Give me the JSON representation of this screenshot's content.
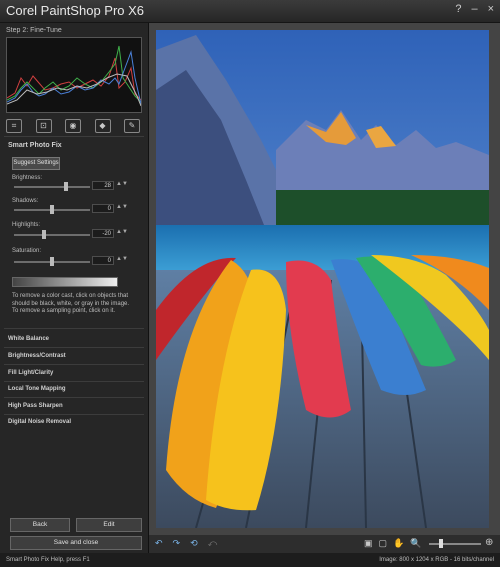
{
  "window": {
    "title": "Corel PaintShop Pro X6",
    "help_label": "?",
    "minimize_label": "–",
    "close_label": "×"
  },
  "left_panel": {
    "step_title": "Step 2: Fine-Tune",
    "smart_photo_fix_title": "Smart Photo Fix",
    "suggest_settings_label": "Suggest Settings",
    "sliders": [
      {
        "label": "Brightness:",
        "value": "28"
      },
      {
        "label": "Shadows:",
        "value": "0"
      },
      {
        "label": "Highlights:",
        "value": "-20"
      },
      {
        "label": "Saturation:",
        "value": "0"
      }
    ],
    "instruction": "To remove a color cast, click on objects that should be black, white, or gray in the image. To remove a sampling point, click on it.",
    "sections": [
      "White Balance",
      "Brightness/Contrast",
      "Fill Light/Clarity",
      "Local Tone Mapping",
      "High Pass Sharpen",
      "Digital Noise Removal"
    ],
    "back_label": "Back",
    "edit_label": "Edit",
    "save_close_label": "Save and close"
  },
  "status": {
    "left": "Smart Photo Fix Help, press F1",
    "right": "Image: 800 x 1204 x RGB - 16 bits/channel"
  },
  "colors": {
    "accent": "#7ab3e6",
    "panel": "#262626"
  }
}
